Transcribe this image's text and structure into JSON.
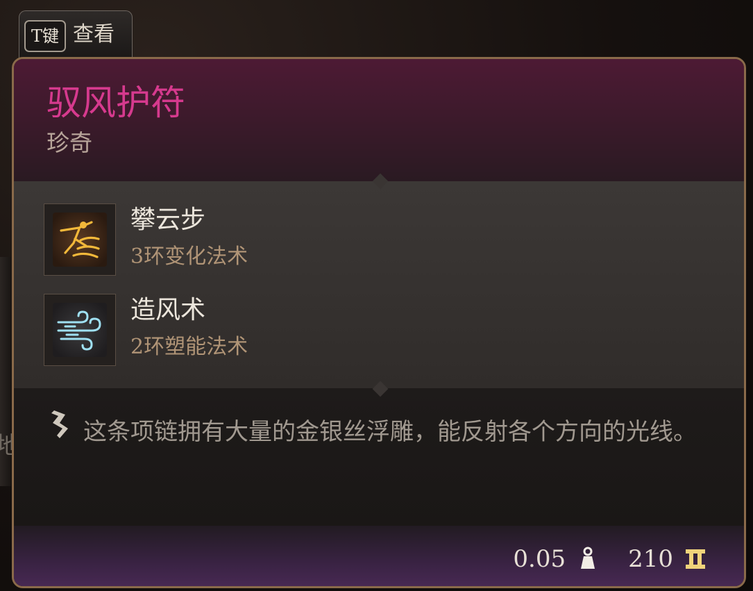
{
  "key_hint": {
    "key": "T键",
    "label": "查看"
  },
  "item": {
    "name": "驭风护符",
    "rarity": "珍奇",
    "name_color": "#d63a8e"
  },
  "spells": [
    {
      "name": "攀云步",
      "school": "3环变化法术",
      "icon": "flying-figure-icon"
    },
    {
      "name": "造风术",
      "school": "2环塑能法术",
      "icon": "wind-gust-icon"
    }
  ],
  "description": {
    "text": "这条项链拥有大量的金银丝浮雕，能反射各个方向的光线。",
    "icon": "quill-icon"
  },
  "footer": {
    "weight": "0.05",
    "weight_icon": "weight-icon",
    "value": "210",
    "value_icon": "gold-coin-icon"
  },
  "background": {
    "edge_char": "地"
  }
}
